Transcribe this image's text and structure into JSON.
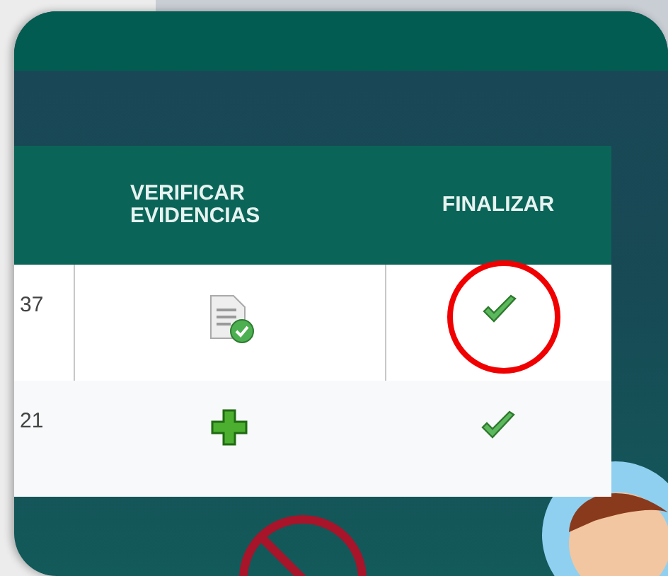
{
  "table": {
    "columns": [
      "",
      "VERIFICAR EVIDENCIAS",
      "FINALIZAR"
    ],
    "rows": [
      {
        "column_1": "37",
        "evidence": {
          "kind": "document"
        },
        "finalize": {
          "kind": "check",
          "circled": true
        }
      },
      {
        "column_1": "21",
        "evidence": {
          "kind": "add"
        },
        "finalize": {
          "kind": "check",
          "circled": false
        }
      }
    ]
  }
}
